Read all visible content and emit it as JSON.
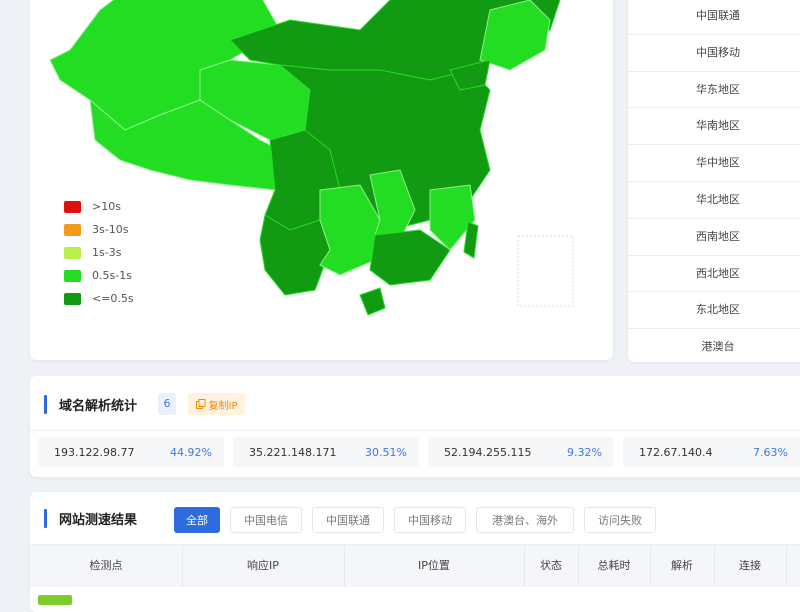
{
  "legend": [
    {
      "label": ">10s",
      "color": "#e01010"
    },
    {
      "label": "3s-10s",
      "color": "#f39a1c"
    },
    {
      "label": "1s-3s",
      "color": "#b8f04a"
    },
    {
      "label": "0.5s-1s",
      "color": "#22dd22"
    },
    {
      "label": "<=0.5s",
      "color": "#139a13"
    }
  ],
  "regions": [
    "中国联通",
    "中国移动",
    "华东地区",
    "华南地区",
    "华中地区",
    "华北地区",
    "西南地区",
    "西北地区",
    "东北地区",
    "港澳台"
  ],
  "dns": {
    "title": "域名解析统计",
    "count": "6",
    "copy_label": "复制IP",
    "entries": [
      {
        "ip": "193.122.98.77",
        "pct": "44.92%"
      },
      {
        "ip": "35.221.148.171",
        "pct": "30.51%"
      },
      {
        "ip": "52.194.255.115",
        "pct": "9.32%"
      },
      {
        "ip": "172.67.140.4",
        "pct": "7.63%"
      }
    ]
  },
  "speed": {
    "title": "网站测速结果",
    "tabs": [
      "全部",
      "中国电信",
      "中国联通",
      "中国移动",
      "港澳台、海外",
      "访问失败"
    ],
    "columns": [
      "检测点",
      "响应IP",
      "IP位置",
      "状态",
      "总耗时",
      "解析",
      "连接"
    ]
  }
}
